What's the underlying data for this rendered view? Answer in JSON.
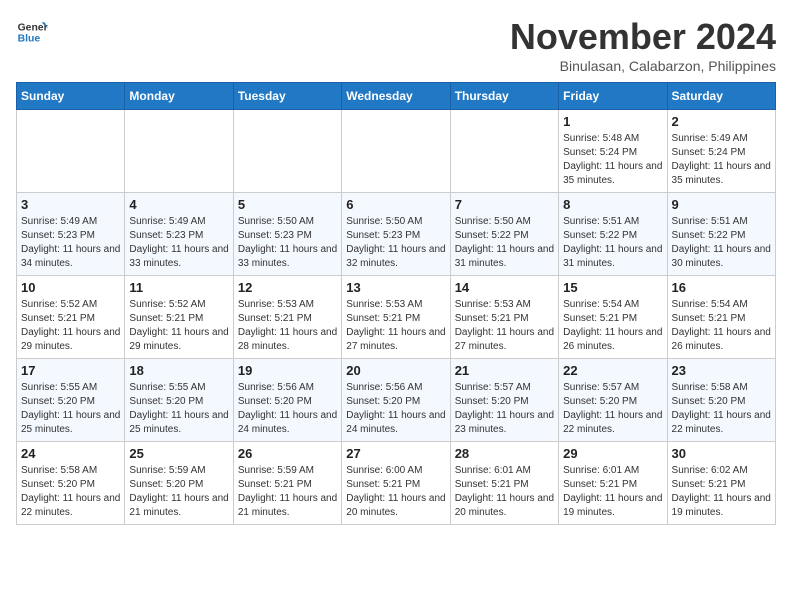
{
  "header": {
    "logo_line1": "General",
    "logo_line2": "Blue",
    "month": "November 2024",
    "location": "Binulasan, Calabarzon, Philippines"
  },
  "weekdays": [
    "Sunday",
    "Monday",
    "Tuesday",
    "Wednesday",
    "Thursday",
    "Friday",
    "Saturday"
  ],
  "weeks": [
    [
      {
        "day": "",
        "sunrise": "",
        "sunset": "",
        "daylight": ""
      },
      {
        "day": "",
        "sunrise": "",
        "sunset": "",
        "daylight": ""
      },
      {
        "day": "",
        "sunrise": "",
        "sunset": "",
        "daylight": ""
      },
      {
        "day": "",
        "sunrise": "",
        "sunset": "",
        "daylight": ""
      },
      {
        "day": "",
        "sunrise": "",
        "sunset": "",
        "daylight": ""
      },
      {
        "day": "1",
        "sunrise": "Sunrise: 5:48 AM",
        "sunset": "Sunset: 5:24 PM",
        "daylight": "Daylight: 11 hours and 35 minutes."
      },
      {
        "day": "2",
        "sunrise": "Sunrise: 5:49 AM",
        "sunset": "Sunset: 5:24 PM",
        "daylight": "Daylight: 11 hours and 35 minutes."
      }
    ],
    [
      {
        "day": "3",
        "sunrise": "Sunrise: 5:49 AM",
        "sunset": "Sunset: 5:23 PM",
        "daylight": "Daylight: 11 hours and 34 minutes."
      },
      {
        "day": "4",
        "sunrise": "Sunrise: 5:49 AM",
        "sunset": "Sunset: 5:23 PM",
        "daylight": "Daylight: 11 hours and 33 minutes."
      },
      {
        "day": "5",
        "sunrise": "Sunrise: 5:50 AM",
        "sunset": "Sunset: 5:23 PM",
        "daylight": "Daylight: 11 hours and 33 minutes."
      },
      {
        "day": "6",
        "sunrise": "Sunrise: 5:50 AM",
        "sunset": "Sunset: 5:23 PM",
        "daylight": "Daylight: 11 hours and 32 minutes."
      },
      {
        "day": "7",
        "sunrise": "Sunrise: 5:50 AM",
        "sunset": "Sunset: 5:22 PM",
        "daylight": "Daylight: 11 hours and 31 minutes."
      },
      {
        "day": "8",
        "sunrise": "Sunrise: 5:51 AM",
        "sunset": "Sunset: 5:22 PM",
        "daylight": "Daylight: 11 hours and 31 minutes."
      },
      {
        "day": "9",
        "sunrise": "Sunrise: 5:51 AM",
        "sunset": "Sunset: 5:22 PM",
        "daylight": "Daylight: 11 hours and 30 minutes."
      }
    ],
    [
      {
        "day": "10",
        "sunrise": "Sunrise: 5:52 AM",
        "sunset": "Sunset: 5:21 PM",
        "daylight": "Daylight: 11 hours and 29 minutes."
      },
      {
        "day": "11",
        "sunrise": "Sunrise: 5:52 AM",
        "sunset": "Sunset: 5:21 PM",
        "daylight": "Daylight: 11 hours and 29 minutes."
      },
      {
        "day": "12",
        "sunrise": "Sunrise: 5:53 AM",
        "sunset": "Sunset: 5:21 PM",
        "daylight": "Daylight: 11 hours and 28 minutes."
      },
      {
        "day": "13",
        "sunrise": "Sunrise: 5:53 AM",
        "sunset": "Sunset: 5:21 PM",
        "daylight": "Daylight: 11 hours and 27 minutes."
      },
      {
        "day": "14",
        "sunrise": "Sunrise: 5:53 AM",
        "sunset": "Sunset: 5:21 PM",
        "daylight": "Daylight: 11 hours and 27 minutes."
      },
      {
        "day": "15",
        "sunrise": "Sunrise: 5:54 AM",
        "sunset": "Sunset: 5:21 PM",
        "daylight": "Daylight: 11 hours and 26 minutes."
      },
      {
        "day": "16",
        "sunrise": "Sunrise: 5:54 AM",
        "sunset": "Sunset: 5:21 PM",
        "daylight": "Daylight: 11 hours and 26 minutes."
      }
    ],
    [
      {
        "day": "17",
        "sunrise": "Sunrise: 5:55 AM",
        "sunset": "Sunset: 5:20 PM",
        "daylight": "Daylight: 11 hours and 25 minutes."
      },
      {
        "day": "18",
        "sunrise": "Sunrise: 5:55 AM",
        "sunset": "Sunset: 5:20 PM",
        "daylight": "Daylight: 11 hours and 25 minutes."
      },
      {
        "day": "19",
        "sunrise": "Sunrise: 5:56 AM",
        "sunset": "Sunset: 5:20 PM",
        "daylight": "Daylight: 11 hours and 24 minutes."
      },
      {
        "day": "20",
        "sunrise": "Sunrise: 5:56 AM",
        "sunset": "Sunset: 5:20 PM",
        "daylight": "Daylight: 11 hours and 24 minutes."
      },
      {
        "day": "21",
        "sunrise": "Sunrise: 5:57 AM",
        "sunset": "Sunset: 5:20 PM",
        "daylight": "Daylight: 11 hours and 23 minutes."
      },
      {
        "day": "22",
        "sunrise": "Sunrise: 5:57 AM",
        "sunset": "Sunset: 5:20 PM",
        "daylight": "Daylight: 11 hours and 22 minutes."
      },
      {
        "day": "23",
        "sunrise": "Sunrise: 5:58 AM",
        "sunset": "Sunset: 5:20 PM",
        "daylight": "Daylight: 11 hours and 22 minutes."
      }
    ],
    [
      {
        "day": "24",
        "sunrise": "Sunrise: 5:58 AM",
        "sunset": "Sunset: 5:20 PM",
        "daylight": "Daylight: 11 hours and 22 minutes."
      },
      {
        "day": "25",
        "sunrise": "Sunrise: 5:59 AM",
        "sunset": "Sunset: 5:20 PM",
        "daylight": "Daylight: 11 hours and 21 minutes."
      },
      {
        "day": "26",
        "sunrise": "Sunrise: 5:59 AM",
        "sunset": "Sunset: 5:21 PM",
        "daylight": "Daylight: 11 hours and 21 minutes."
      },
      {
        "day": "27",
        "sunrise": "Sunrise: 6:00 AM",
        "sunset": "Sunset: 5:21 PM",
        "daylight": "Daylight: 11 hours and 20 minutes."
      },
      {
        "day": "28",
        "sunrise": "Sunrise: 6:01 AM",
        "sunset": "Sunset: 5:21 PM",
        "daylight": "Daylight: 11 hours and 20 minutes."
      },
      {
        "day": "29",
        "sunrise": "Sunrise: 6:01 AM",
        "sunset": "Sunset: 5:21 PM",
        "daylight": "Daylight: 11 hours and 19 minutes."
      },
      {
        "day": "30",
        "sunrise": "Sunrise: 6:02 AM",
        "sunset": "Sunset: 5:21 PM",
        "daylight": "Daylight: 11 hours and 19 minutes."
      }
    ]
  ]
}
